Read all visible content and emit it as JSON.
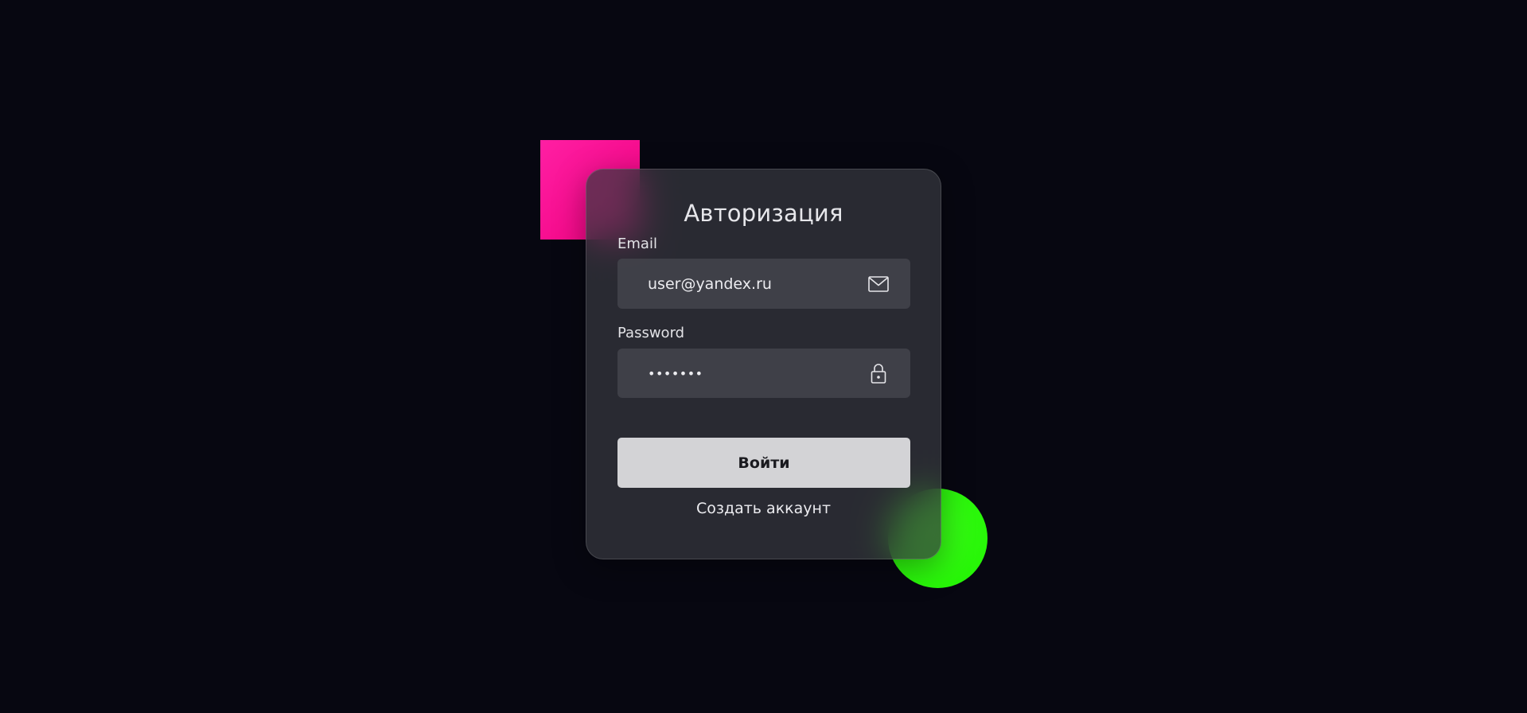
{
  "form": {
    "title": "Авторизация",
    "email": {
      "label": "Email",
      "value": "user@yandex.ru",
      "placeholder": "",
      "icon": "mail-icon"
    },
    "password": {
      "label": "Password",
      "value": "•••••••",
      "placeholder": "",
      "icon": "lock-icon"
    },
    "submit_label": "Войти",
    "create_account_label": "Создать аккаунт"
  },
  "colors": {
    "background": "#070711",
    "accent_pink": "#f5008a",
    "accent_green": "#2af50a",
    "button_bg": "#d3d3d6"
  }
}
